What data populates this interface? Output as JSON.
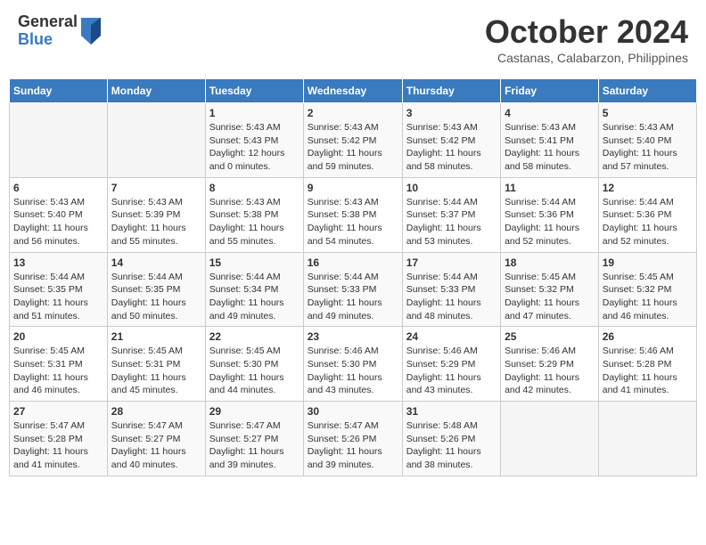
{
  "header": {
    "logo_general": "General",
    "logo_blue": "Blue",
    "month": "October 2024",
    "location": "Castanas, Calabarzon, Philippines"
  },
  "days_of_week": [
    "Sunday",
    "Monday",
    "Tuesday",
    "Wednesday",
    "Thursday",
    "Friday",
    "Saturday"
  ],
  "weeks": [
    [
      {
        "day": "",
        "content": ""
      },
      {
        "day": "",
        "content": ""
      },
      {
        "day": "1",
        "content": "Sunrise: 5:43 AM\nSunset: 5:43 PM\nDaylight: 12 hours and 0 minutes."
      },
      {
        "day": "2",
        "content": "Sunrise: 5:43 AM\nSunset: 5:42 PM\nDaylight: 11 hours and 59 minutes."
      },
      {
        "day": "3",
        "content": "Sunrise: 5:43 AM\nSunset: 5:42 PM\nDaylight: 11 hours and 58 minutes."
      },
      {
        "day": "4",
        "content": "Sunrise: 5:43 AM\nSunset: 5:41 PM\nDaylight: 11 hours and 58 minutes."
      },
      {
        "day": "5",
        "content": "Sunrise: 5:43 AM\nSunset: 5:40 PM\nDaylight: 11 hours and 57 minutes."
      }
    ],
    [
      {
        "day": "6",
        "content": "Sunrise: 5:43 AM\nSunset: 5:40 PM\nDaylight: 11 hours and 56 minutes."
      },
      {
        "day": "7",
        "content": "Sunrise: 5:43 AM\nSunset: 5:39 PM\nDaylight: 11 hours and 55 minutes."
      },
      {
        "day": "8",
        "content": "Sunrise: 5:43 AM\nSunset: 5:38 PM\nDaylight: 11 hours and 55 minutes."
      },
      {
        "day": "9",
        "content": "Sunrise: 5:43 AM\nSunset: 5:38 PM\nDaylight: 11 hours and 54 minutes."
      },
      {
        "day": "10",
        "content": "Sunrise: 5:44 AM\nSunset: 5:37 PM\nDaylight: 11 hours and 53 minutes."
      },
      {
        "day": "11",
        "content": "Sunrise: 5:44 AM\nSunset: 5:36 PM\nDaylight: 11 hours and 52 minutes."
      },
      {
        "day": "12",
        "content": "Sunrise: 5:44 AM\nSunset: 5:36 PM\nDaylight: 11 hours and 52 minutes."
      }
    ],
    [
      {
        "day": "13",
        "content": "Sunrise: 5:44 AM\nSunset: 5:35 PM\nDaylight: 11 hours and 51 minutes."
      },
      {
        "day": "14",
        "content": "Sunrise: 5:44 AM\nSunset: 5:35 PM\nDaylight: 11 hours and 50 minutes."
      },
      {
        "day": "15",
        "content": "Sunrise: 5:44 AM\nSunset: 5:34 PM\nDaylight: 11 hours and 49 minutes."
      },
      {
        "day": "16",
        "content": "Sunrise: 5:44 AM\nSunset: 5:33 PM\nDaylight: 11 hours and 49 minutes."
      },
      {
        "day": "17",
        "content": "Sunrise: 5:44 AM\nSunset: 5:33 PM\nDaylight: 11 hours and 48 minutes."
      },
      {
        "day": "18",
        "content": "Sunrise: 5:45 AM\nSunset: 5:32 PM\nDaylight: 11 hours and 47 minutes."
      },
      {
        "day": "19",
        "content": "Sunrise: 5:45 AM\nSunset: 5:32 PM\nDaylight: 11 hours and 46 minutes."
      }
    ],
    [
      {
        "day": "20",
        "content": "Sunrise: 5:45 AM\nSunset: 5:31 PM\nDaylight: 11 hours and 46 minutes."
      },
      {
        "day": "21",
        "content": "Sunrise: 5:45 AM\nSunset: 5:31 PM\nDaylight: 11 hours and 45 minutes."
      },
      {
        "day": "22",
        "content": "Sunrise: 5:45 AM\nSunset: 5:30 PM\nDaylight: 11 hours and 44 minutes."
      },
      {
        "day": "23",
        "content": "Sunrise: 5:46 AM\nSunset: 5:30 PM\nDaylight: 11 hours and 43 minutes."
      },
      {
        "day": "24",
        "content": "Sunrise: 5:46 AM\nSunset: 5:29 PM\nDaylight: 11 hours and 43 minutes."
      },
      {
        "day": "25",
        "content": "Sunrise: 5:46 AM\nSunset: 5:29 PM\nDaylight: 11 hours and 42 minutes."
      },
      {
        "day": "26",
        "content": "Sunrise: 5:46 AM\nSunset: 5:28 PM\nDaylight: 11 hours and 41 minutes."
      }
    ],
    [
      {
        "day": "27",
        "content": "Sunrise: 5:47 AM\nSunset: 5:28 PM\nDaylight: 11 hours and 41 minutes."
      },
      {
        "day": "28",
        "content": "Sunrise: 5:47 AM\nSunset: 5:27 PM\nDaylight: 11 hours and 40 minutes."
      },
      {
        "day": "29",
        "content": "Sunrise: 5:47 AM\nSunset: 5:27 PM\nDaylight: 11 hours and 39 minutes."
      },
      {
        "day": "30",
        "content": "Sunrise: 5:47 AM\nSunset: 5:26 PM\nDaylight: 11 hours and 39 minutes."
      },
      {
        "day": "31",
        "content": "Sunrise: 5:48 AM\nSunset: 5:26 PM\nDaylight: 11 hours and 38 minutes."
      },
      {
        "day": "",
        "content": ""
      },
      {
        "day": "",
        "content": ""
      }
    ]
  ]
}
